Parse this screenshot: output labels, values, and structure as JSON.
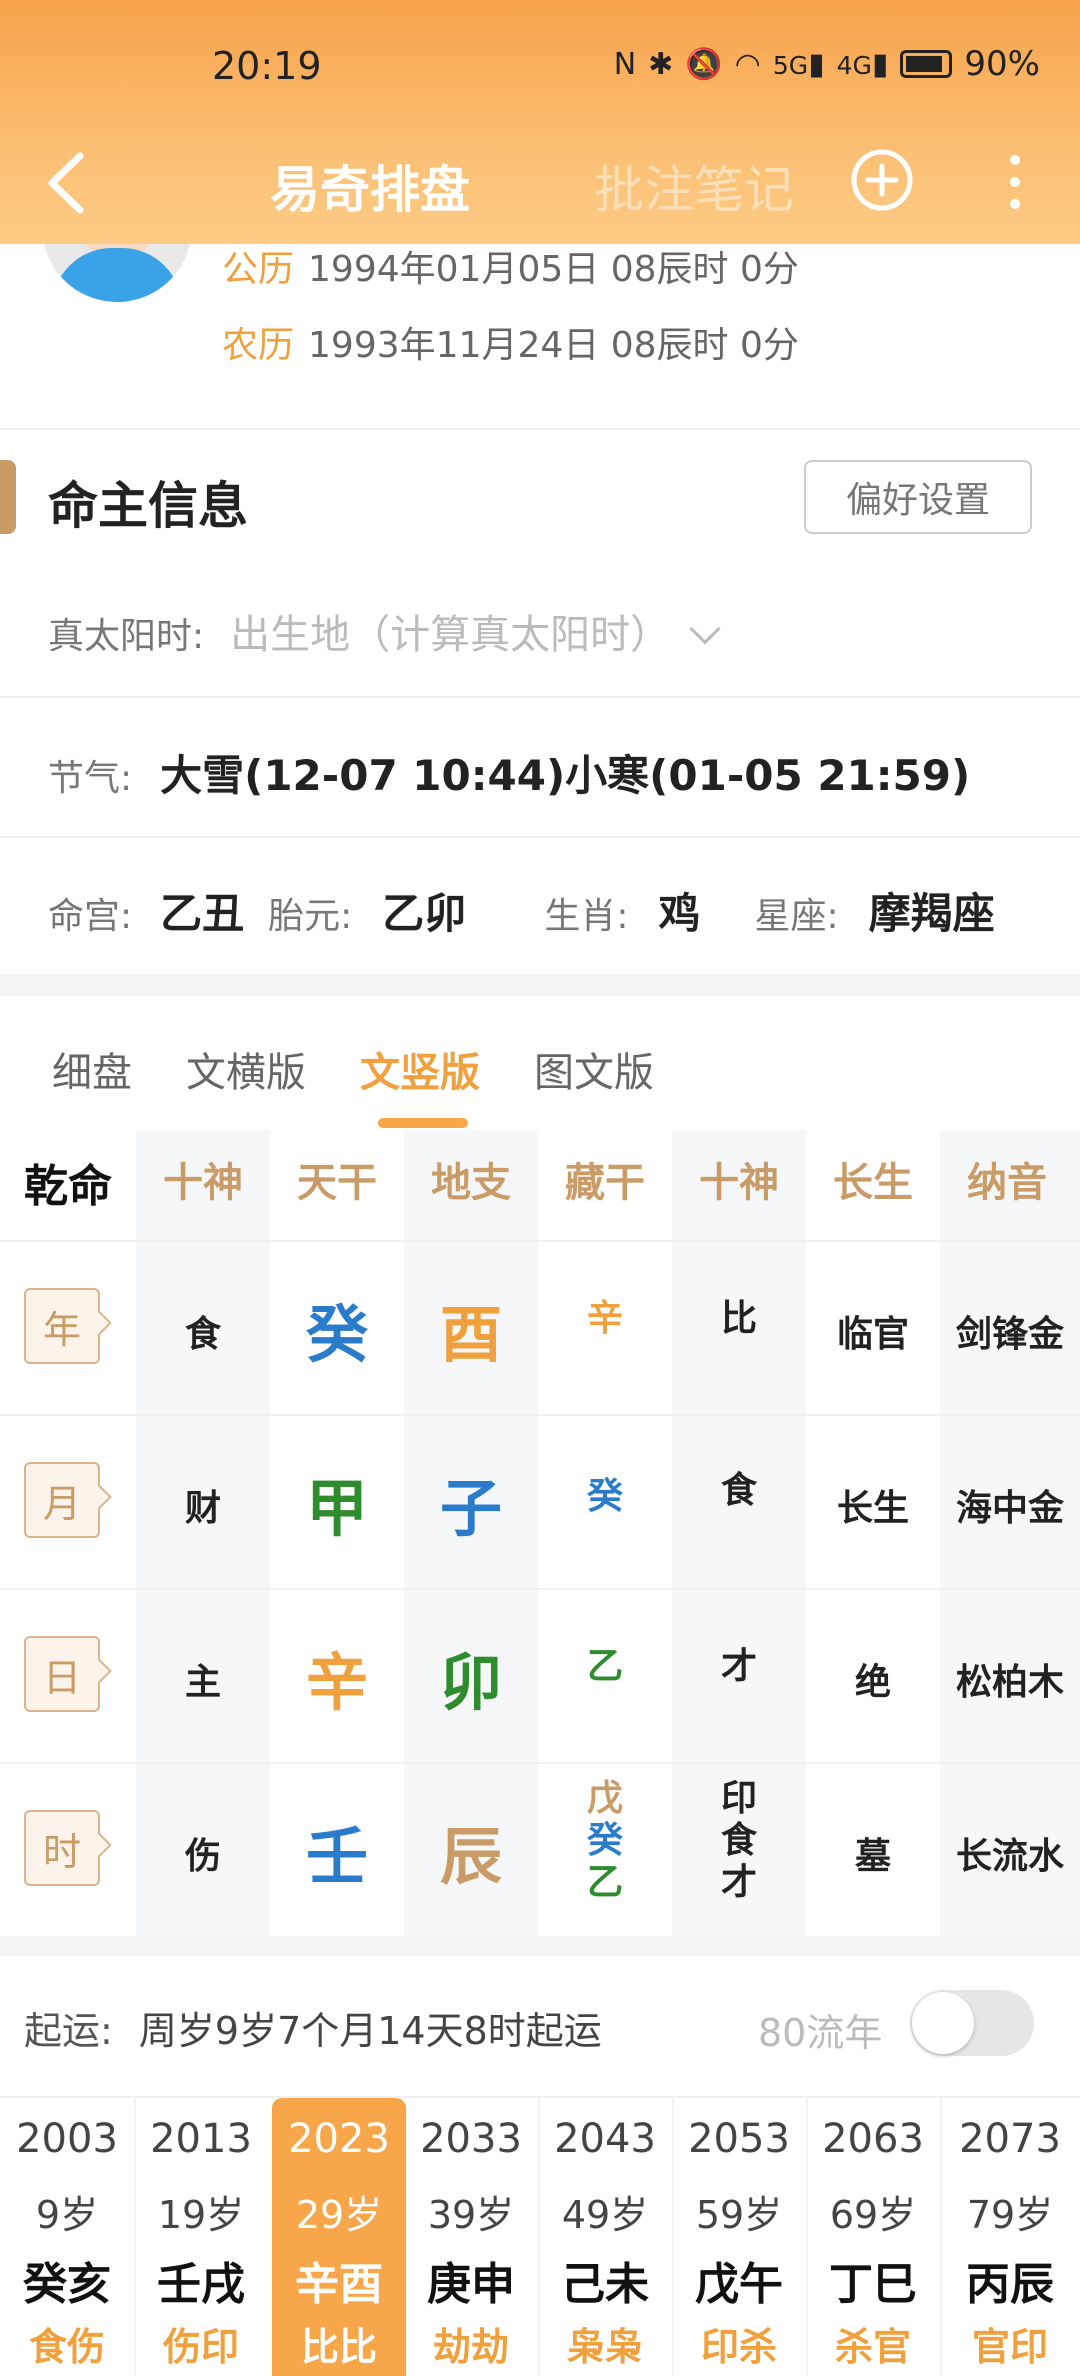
{
  "status": {
    "time": "20:19",
    "battery": "90%",
    "net1": "5G",
    "net2": "4G"
  },
  "nav": {
    "title": "易奇排盘",
    "notes": "批注笔记"
  },
  "profile": {
    "solar_tag": "公历",
    "solar_date": "1994年01月05日 08辰时 0分",
    "lunar_tag": "农历",
    "lunar_date": "1993年11月24日 08辰时 0分"
  },
  "section": {
    "title": "命主信息",
    "pref_button": "偏好设置"
  },
  "true_solar": {
    "label": "真太阳时:",
    "value": "出生地（计算真太阳时）"
  },
  "solar_terms": {
    "label": "节气:",
    "value": "大雪(12-07 10:44)小寒(01-05 21:59)"
  },
  "extra": {
    "minggong_label": "命宫:",
    "minggong": "乙丑",
    "taiyuan_label": "胎元:",
    "taiyuan": "乙卯",
    "zodiac_label": "生肖:",
    "zodiac": "鸡",
    "constellation_label": "星座:",
    "constellation": "摩羯座"
  },
  "tabs": [
    "细盘",
    "文横版",
    "文竖版",
    "图文版"
  ],
  "active_tab": "文竖版",
  "table": {
    "gender": "乾命",
    "headers": [
      "十神",
      "天干",
      "地支",
      "藏干",
      "十神",
      "长生",
      "纳音"
    ],
    "rows": [
      {
        "pillar": "年",
        "god": "食",
        "stem": "癸",
        "branch": "酉",
        "hidden": [
          "辛"
        ],
        "hidden_gods": [
          "比"
        ],
        "stage": "临官",
        "nayin": "剑锋金"
      },
      {
        "pillar": "月",
        "god": "财",
        "stem": "甲",
        "branch": "子",
        "hidden": [
          "癸"
        ],
        "hidden_gods": [
          "食"
        ],
        "stage": "长生",
        "nayin": "海中金"
      },
      {
        "pillar": "日",
        "god": "主",
        "stem": "辛",
        "branch": "卯",
        "hidden": [
          "乙"
        ],
        "hidden_gods": [
          "才"
        ],
        "stage": "绝",
        "nayin": "松柏木"
      },
      {
        "pillar": "时",
        "god": "伤",
        "stem": "壬",
        "branch": "辰",
        "hidden": [
          "戊",
          "癸",
          "乙"
        ],
        "hidden_gods": [
          "印",
          "食",
          "才"
        ],
        "stage": "墓",
        "nayin": "长流水"
      }
    ],
    "colors": {
      "water": "#2a7ccb",
      "metal": "#f0a03c",
      "wood": "#2e8b2e",
      "earth": "#c99b66"
    }
  },
  "luck": {
    "label": "起运:",
    "value": "周岁9岁7个月14天8时起运",
    "liunian": "80流年",
    "columns": [
      {
        "year": "2003",
        "age": "9岁",
        "gz": "癸亥",
        "gods": "食伤"
      },
      {
        "year": "2013",
        "age": "19岁",
        "gz": "壬戌",
        "gods": "伤印"
      },
      {
        "year": "2023",
        "age": "29岁",
        "gz": "辛酉",
        "gods": "比比"
      },
      {
        "year": "2033",
        "age": "39岁",
        "gz": "庚申",
        "gods": "劫劫"
      },
      {
        "year": "2043",
        "age": "49岁",
        "gz": "己未",
        "gods": "枭枭"
      },
      {
        "year": "2053",
        "age": "59岁",
        "gz": "戊午",
        "gods": "印杀"
      },
      {
        "year": "2063",
        "age": "69岁",
        "gz": "丁巳",
        "gods": "杀官"
      },
      {
        "year": "2073",
        "age": "79岁",
        "gz": "丙辰",
        "gods": "官印"
      }
    ],
    "active_index": 2
  }
}
